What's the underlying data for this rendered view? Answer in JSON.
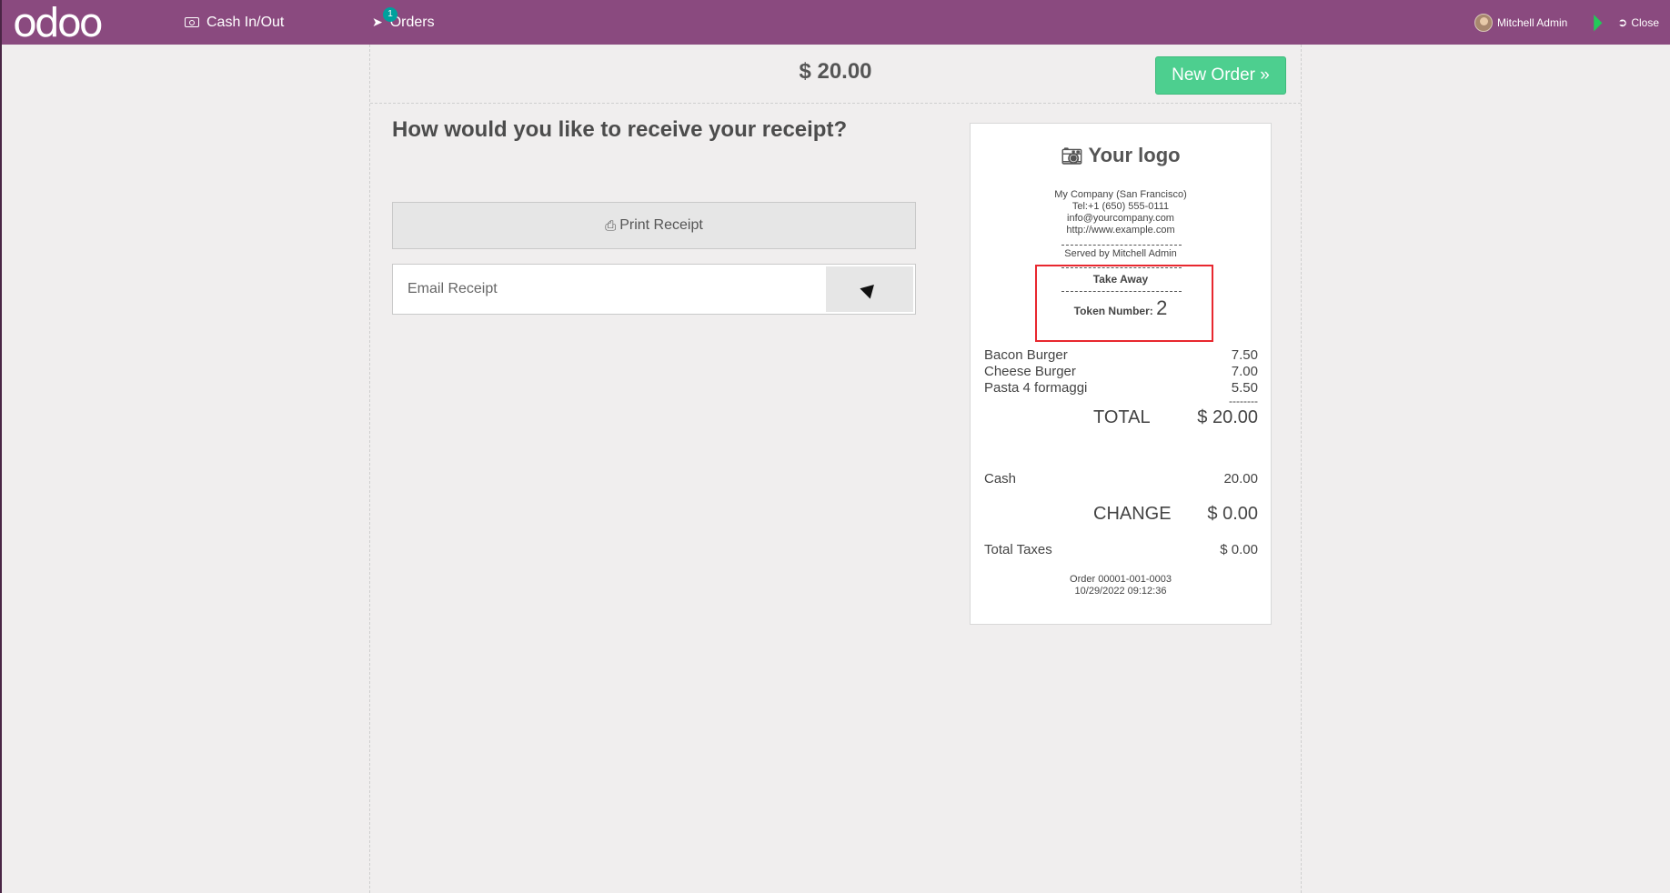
{
  "navbar": {
    "logo": "odoo",
    "cash_label": "Cash In/Out",
    "orders_label": "Orders",
    "orders_count": "1",
    "user_name": "Mitchell Admin",
    "close_label": "Close",
    "bar_color": "#8a4a7f"
  },
  "payment": {
    "total": "$ 20.00",
    "new_order_label": "New Order »",
    "question": "How would you like to receive your receipt?",
    "print_label": "Print Receipt",
    "email_placeholder": "Email Receipt"
  },
  "receipt": {
    "logo_text": "Your logo",
    "company": "My Company (San Francisco)",
    "tel": "Tel:+1 (650) 555-0111",
    "email": "info@yourcompany.com",
    "website": "http://www.example.com",
    "served_by": "Served by Mitchell Admin",
    "take_away": "Take Away",
    "token_label": "Token Number:",
    "token_number": "2",
    "lines": [
      {
        "name": "Bacon Burger",
        "price": "7.50"
      },
      {
        "name": "Cheese Burger",
        "price": "7.00"
      },
      {
        "name": "Pasta 4 formaggi",
        "price": "5.50"
      }
    ],
    "separator": "--------",
    "total_label": "TOTAL",
    "total_value": "$ 20.00",
    "cash_label": "Cash",
    "cash_value": "20.00",
    "change_label": "CHANGE",
    "change_value": "$ 0.00",
    "taxes_label": "Total Taxes",
    "taxes_value": "$ 0.00",
    "order_ref": "Order 00001-001-0003",
    "order_date": "10/29/2022 09:12:36"
  }
}
